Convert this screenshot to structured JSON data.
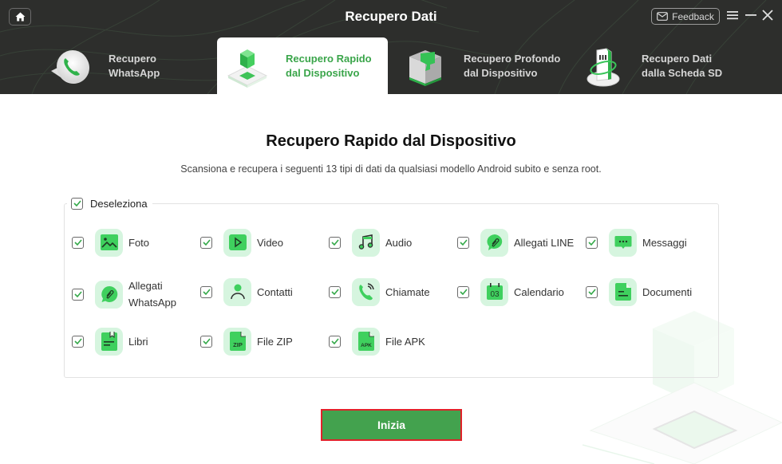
{
  "window": {
    "title": "Recupero Dati",
    "feedback_label": "Feedback"
  },
  "tabs": [
    {
      "id": "whatsapp",
      "label": "Recupero\nWhatsApp",
      "active": false
    },
    {
      "id": "quick",
      "label": "Recupero Rapido\ndal Dispositivo",
      "active": true
    },
    {
      "id": "deep",
      "label": "Recupero Profondo\ndal Dispositivo",
      "active": false
    },
    {
      "id": "sd",
      "label": "Recupero Dati\ndalla Scheda SD",
      "active": false
    }
  ],
  "main": {
    "title": "Recupero Rapido dal Dispositivo",
    "subtitle": "Scansiona e recupera i seguenti 13 tipi di dati da qualsiasi modello Android subito e senza root.",
    "deselect_label": "Deseleziona",
    "deselect_checked": true,
    "start_label": "Inizia"
  },
  "data_types": [
    {
      "label": "Foto",
      "icon": "photo-icon",
      "checked": true
    },
    {
      "label": "Video",
      "icon": "video-icon",
      "checked": true
    },
    {
      "label": "Audio",
      "icon": "music-icon",
      "checked": true
    },
    {
      "label": "Allegati LINE",
      "icon": "line-attachment-icon",
      "checked": true
    },
    {
      "label": "Messaggi",
      "icon": "message-icon",
      "checked": true
    },
    {
      "label": "Allegati WhatsApp",
      "icon": "whatsapp-attachment-icon",
      "checked": true
    },
    {
      "label": "Contatti",
      "icon": "contact-icon",
      "checked": true
    },
    {
      "label": "Chiamate",
      "icon": "call-icon",
      "checked": true
    },
    {
      "label": "Calendario",
      "icon": "calendar-icon",
      "checked": true,
      "icon_text": "03"
    },
    {
      "label": "Documenti",
      "icon": "document-icon",
      "checked": true
    },
    {
      "label": "Libri",
      "icon": "book-icon",
      "checked": true
    },
    {
      "label": "File ZIP",
      "icon": "zip-file-icon",
      "checked": true,
      "icon_text": "ZIP"
    },
    {
      "label": "File APK",
      "icon": "apk-file-icon",
      "checked": true,
      "icon_text": "APK"
    }
  ],
  "colors": {
    "accent": "#3aa54a",
    "header_bg": "#2d2e2c",
    "button_bg": "#43a24e",
    "button_highlight": "#e1212a",
    "icon_bg": "#d6f5df"
  }
}
